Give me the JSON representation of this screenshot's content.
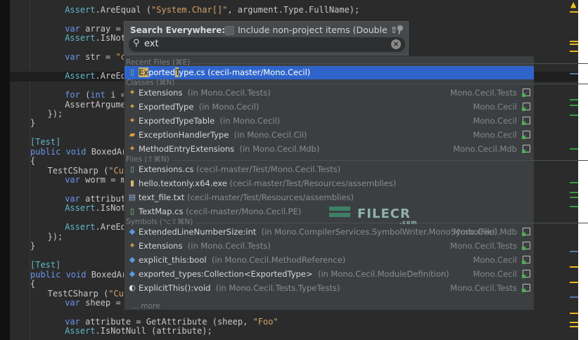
{
  "editor": {
    "lines": [
      {
        "indent": 4,
        "tokens": [
          [
            "cls",
            "Assert"
          ],
          [
            "",
            ".AreEqual ("
          ],
          [
            "str",
            "\"System.Char[]\""
          ],
          [
            "",
            ", argument.Type.FullName);"
          ]
        ]
      },
      {
        "indent": -1,
        "tokens": []
      },
      {
        "indent": 4,
        "tokens": [
          [
            "kw",
            "var"
          ],
          [
            "",
            " array = a"
          ]
        ]
      },
      {
        "indent": 4,
        "tokens": [
          [
            "cls",
            "Assert"
          ],
          [
            "",
            ".IsNotN"
          ]
        ]
      },
      {
        "indent": -1,
        "tokens": []
      },
      {
        "indent": 4,
        "tokens": [
          [
            "kw",
            "var"
          ],
          [
            "",
            " str = "
          ],
          [
            "str",
            "\"ce"
          ]
        ]
      },
      {
        "indent": -1,
        "tokens": []
      },
      {
        "indent": 4,
        "tokens": [
          [
            "cls",
            "Assert"
          ],
          [
            "",
            ".AreEqu"
          ]
        ]
      },
      {
        "indent": -1,
        "tokens": []
      },
      {
        "indent": 4,
        "tokens": [
          [
            "kw",
            "for"
          ],
          [
            "",
            " ("
          ],
          [
            "kw",
            "int"
          ],
          [
            "",
            " i = "
          ]
        ]
      },
      {
        "indent": 4,
        "tokens": [
          [
            "",
            "AssertArgumen"
          ]
        ]
      },
      {
        "indent": 2,
        "tokens": [
          [
            "",
            "});"
          ]
        ]
      },
      {
        "indent": 0,
        "tokens": [
          [
            "",
            "}"
          ]
        ]
      },
      {
        "indent": -1,
        "tokens": []
      },
      {
        "indent": 0,
        "tokens": [
          [
            "attr",
            "[Test]"
          ]
        ]
      },
      {
        "indent": 0,
        "tokens": [
          [
            "kw",
            "public void"
          ],
          [
            "",
            " BoxedArgu"
          ]
        ]
      },
      {
        "indent": 0,
        "tokens": [
          [
            "",
            "{"
          ]
        ]
      },
      {
        "indent": 2,
        "tokens": [
          [
            "",
            "TestCSharp ("
          ],
          [
            "str",
            "\"Cust"
          ]
        ]
      },
      {
        "indent": 4,
        "tokens": [
          [
            "kw",
            "var"
          ],
          [
            "",
            " worm = mo"
          ]
        ]
      },
      {
        "indent": -1,
        "tokens": []
      },
      {
        "indent": 4,
        "tokens": [
          [
            "kw",
            "var"
          ],
          [
            "",
            " attribute"
          ]
        ]
      },
      {
        "indent": 4,
        "tokens": [
          [
            "cls",
            "Assert"
          ],
          [
            "",
            ".IsNotN"
          ]
        ]
      },
      {
        "indent": -1,
        "tokens": []
      },
      {
        "indent": 4,
        "tokens": [
          [
            "cls",
            "Assert"
          ],
          [
            "",
            ".AreEqu"
          ]
        ]
      },
      {
        "indent": 2,
        "tokens": [
          [
            "",
            "});"
          ]
        ]
      },
      {
        "indent": 0,
        "tokens": [
          [
            "",
            "}"
          ]
        ]
      },
      {
        "indent": -1,
        "tokens": []
      },
      {
        "indent": 0,
        "tokens": [
          [
            "attr",
            "[Test]"
          ]
        ]
      },
      {
        "indent": 0,
        "tokens": [
          [
            "kw",
            "public void"
          ],
          [
            "",
            " BoxedArra"
          ]
        ]
      },
      {
        "indent": 0,
        "tokens": [
          [
            "",
            "{"
          ]
        ]
      },
      {
        "indent": 2,
        "tokens": [
          [
            "",
            "TestCSharp ("
          ],
          [
            "str",
            "\"Cust"
          ]
        ]
      },
      {
        "indent": 4,
        "tokens": [
          [
            "kw",
            "var"
          ],
          [
            "",
            " sheep = m"
          ]
        ]
      },
      {
        "indent": -1,
        "tokens": []
      },
      {
        "indent": 4,
        "tokens": [
          [
            "kw",
            "var"
          ],
          [
            "",
            " attribute = GetAttribute (sheep, "
          ],
          [
            "str",
            "\"Foo\""
          ],
          [
            ");"
          ]
        ]
      },
      {
        "indent": 4,
        "tokens": [
          [
            "cls",
            "Assert"
          ],
          [
            "",
            ".IsNotNull (attribute);"
          ]
        ]
      }
    ]
  },
  "search": {
    "title": "Search Everywhere:",
    "include_label": "Include non-project items (Double ⇧)",
    "include_checked": false,
    "query": "ext",
    "more": "... more",
    "groups": [
      {
        "header": "Recent Files (⌘E)",
        "rows": [
          {
            "icon": "cs-file-icon",
            "parts": [
              {
                "t": "Ex",
                "m": true
              },
              {
                "t": "ported"
              },
              {
                "t": "T",
                "m": true
              },
              {
                "t": "ype.cs"
              }
            ],
            "path": "(cecil-master/Mono.Cecil)",
            "selected": true
          }
        ]
      },
      {
        "header": "Classes (⌘N)",
        "rows": [
          {
            "icon": "class-icon",
            "parts": [
              {
                "t": "Extensions"
              }
            ],
            "path": "(in Mono.Cecil.Tests)",
            "module": "Mono.Cecil.Tests"
          },
          {
            "icon": "class-icon",
            "parts": [
              {
                "t": "ExportedType"
              }
            ],
            "path": "(in Mono.Cecil)",
            "module": "Mono.Cecil"
          },
          {
            "icon": "class-icon",
            "parts": [
              {
                "t": "ExportedTypeTable"
              }
            ],
            "path": "(in Mono.Cecil)",
            "module": "Mono.Cecil"
          },
          {
            "icon": "enum-icon",
            "parts": [
              {
                "t": "ExceptionHandlerType"
              }
            ],
            "path": "(in Mono.Cecil.Cil)",
            "module": "Mono.Cecil"
          },
          {
            "icon": "class-icon",
            "parts": [
              {
                "t": "MethodEntryExtensions"
              }
            ],
            "path": "(in Mono.Cecil.Mdb)",
            "module": "Mono.Cecil.Mdb"
          }
        ]
      },
      {
        "header": "Files (⇧⌘N)",
        "rows": [
          {
            "icon": "cs-file-icon",
            "parts": [
              {
                "t": "Extensions.cs"
              }
            ],
            "path": "(cecil-master/Test/Mono.Cecil.Tests)"
          },
          {
            "icon": "binary-file-icon",
            "parts": [
              {
                "t": "hello.textonly.x64.exe"
              }
            ],
            "path": "(cecil-master/Test/Resources/assemblies)"
          },
          {
            "icon": "text-file-icon",
            "parts": [
              {
                "t": "text_file.txt"
              }
            ],
            "path": "(cecil-master/Test/Resources/assemblies)"
          },
          {
            "icon": "cs-file-icon",
            "parts": [
              {
                "t": "TextMap.cs"
              }
            ],
            "path": "(cecil-master/Mono.Cecil.PE)"
          }
        ]
      },
      {
        "header": "Symbols (⌥⇧⌘N)",
        "rows": [
          {
            "icon": "field-icon",
            "parts": [
              {
                "t": "ExtendedLineNumberSize:int"
              }
            ],
            "path": "(in Mono.CompilerServices.SymbolWriter.MonoSymbolFile)",
            "module": "Mono.Cecil.Mdb"
          },
          {
            "icon": "class-icon",
            "parts": [
              {
                "t": "Extensions"
              }
            ],
            "path": "(in Mono.Cecil.Tests)",
            "module": "Mono.Cecil.Tests"
          },
          {
            "icon": "field-icon",
            "parts": [
              {
                "t": "explicit_this:bool"
              }
            ],
            "path": "(in Mono.Cecil.MethodReference)",
            "module": "Mono.Cecil"
          },
          {
            "icon": "field-icon",
            "parts": [
              {
                "t": "exported_types:Collection<ExportedType>"
              }
            ],
            "path": "(in Mono.Cecil.ModuleDefinition)",
            "module": "Mono.Cecil"
          },
          {
            "icon": "method-icon",
            "parts": [
              {
                "t": "ExplicitThis():void"
              }
            ],
            "path": "(in Mono.Cecil.Tests.TypeTests)",
            "module": "Mono.Cecil.Tests"
          }
        ]
      }
    ]
  },
  "watermark": {
    "text": "FILECR",
    "sub": ".com"
  },
  "colors": {
    "selection": "#2f65ca",
    "match_highlight": "#c8b06a",
    "warning": "#f0c020"
  }
}
